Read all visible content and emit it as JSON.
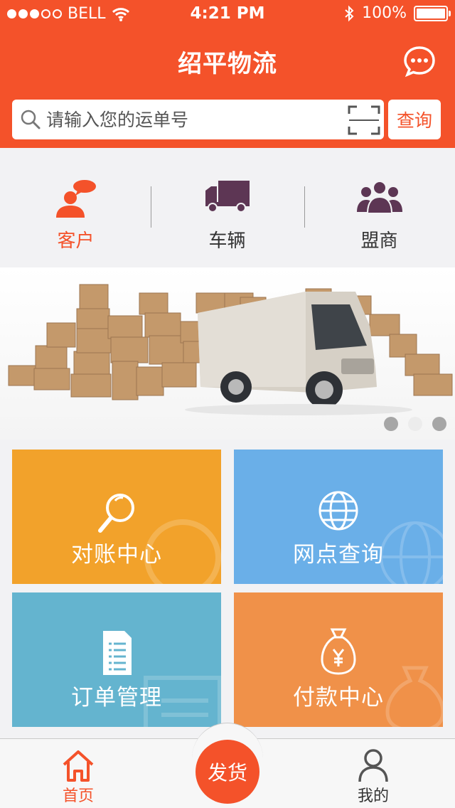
{
  "status_bar": {
    "carrier": "BELL",
    "time": "4:21 PM",
    "battery": "100%",
    "signal_bars_filled": 3,
    "signal_bars_total": 5
  },
  "header": {
    "title": "绍平物流",
    "message_icon": "chat-bubble-icon"
  },
  "search": {
    "placeholder": "请输入您的运单号",
    "button_label": "查询",
    "scan_icon": "scan-frame-icon"
  },
  "roles": [
    {
      "label": "客户",
      "icon": "customer-icon",
      "active": true
    },
    {
      "label": "车辆",
      "icon": "truck-icon",
      "active": false
    },
    {
      "label": "盟商",
      "icon": "partners-icon",
      "active": false
    }
  ],
  "banner": {
    "slides": 3,
    "current_slide": 2
  },
  "tiles": [
    {
      "label": "对账中心",
      "icon": "magnifier-icon",
      "color": "#f2a22b"
    },
    {
      "label": "网点查询",
      "icon": "globe-icon",
      "color": "#6aafe8"
    },
    {
      "label": "订单管理",
      "icon": "document-icon",
      "color": "#64b4cf"
    },
    {
      "label": "付款中心",
      "icon": "money-bag-icon",
      "color": "#f09149"
    }
  ],
  "tabbar": {
    "home_label": "首页",
    "ship_label": "发货",
    "mine_label": "我的",
    "active_tab": "首页"
  },
  "colors": {
    "brand": "#f4522a",
    "role_icon_active": "#f4522a",
    "role_icon_inactive": "#5d3654"
  }
}
